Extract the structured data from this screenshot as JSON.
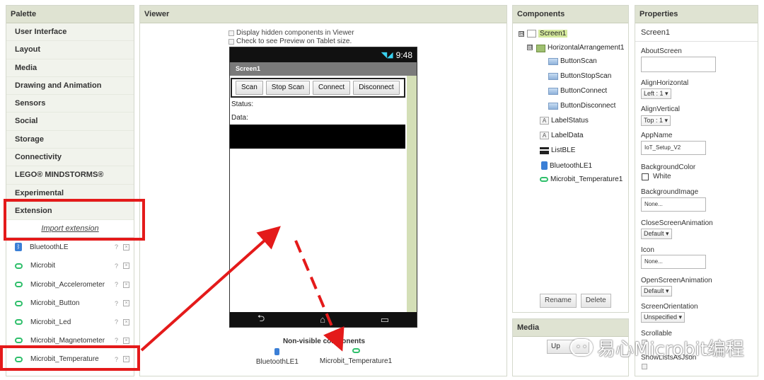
{
  "palette": {
    "title": "Palette",
    "categories": [
      "User Interface",
      "Layout",
      "Media",
      "Drawing and Animation",
      "Sensors",
      "Social",
      "Storage",
      "Connectivity",
      "LEGO® MINDSTORMS®",
      "Experimental",
      "Extension"
    ],
    "import_link": "Import extension",
    "extensions": [
      {
        "label": "BluetoothLE",
        "icon": "bluetooth-icon"
      },
      {
        "label": "Microbit",
        "icon": "microbit-icon"
      },
      {
        "label": "Microbit_Accelerometer",
        "icon": "microbit-icon"
      },
      {
        "label": "Microbit_Button",
        "icon": "microbit-icon"
      },
      {
        "label": "Microbit_Led",
        "icon": "microbit-icon"
      },
      {
        "label": "Microbit_Magnetometer",
        "icon": "microbit-icon"
      },
      {
        "label": "Microbit_Temperature",
        "icon": "microbit-icon"
      }
    ],
    "help_glyph": "?",
    "remove_glyph": "×"
  },
  "viewer": {
    "title": "Viewer",
    "display_hidden": "Display hidden components in Viewer",
    "tablet_preview": "Check to see Preview on Tablet size.",
    "phone": {
      "time": "9:48",
      "screen_title": "Screen1",
      "buttons": [
        "Scan",
        "Stop Scan",
        "Connect",
        "Disconnect"
      ],
      "status_label": "Status:",
      "data_label": "Data:",
      "nav_back": "⮌",
      "nav_home": "⌂",
      "nav_recent": "▭"
    },
    "non_visible_title": "Non-visible components",
    "non_visible_items": [
      "BluetoothLE1",
      "Microbit_Temperature1"
    ]
  },
  "components": {
    "title": "Components",
    "tree": [
      {
        "label": "Screen1",
        "icon": "screen-icon",
        "toggle": "⊟"
      },
      {
        "label": "HorizontalArrangement1",
        "icon": "arrangement-icon",
        "toggle": "⊟"
      },
      {
        "label": "ButtonScan",
        "icon": "button-icon"
      },
      {
        "label": "ButtonStopScan",
        "icon": "button-icon"
      },
      {
        "label": "ButtonConnect",
        "icon": "button-icon"
      },
      {
        "label": "ButtonDisconnect",
        "icon": "button-icon"
      },
      {
        "label": "LabelStatus",
        "icon": "label-icon"
      },
      {
        "label": "LabelData",
        "icon": "label-icon"
      },
      {
        "label": "ListBLE",
        "icon": "listview-icon"
      },
      {
        "label": "BluetoothLE1",
        "icon": "bluetooth-icon"
      },
      {
        "label": "Microbit_Temperature1",
        "icon": "microbit-icon"
      }
    ],
    "label_glyph": "A",
    "rename": "Rename",
    "delete": "Delete"
  },
  "media": {
    "title": "Media",
    "upload": "Up"
  },
  "properties": {
    "title": "Properties",
    "component": "Screen1",
    "about_screen": "AboutScreen",
    "align_horizontal": "AlignHorizontal",
    "align_horizontal_value": "Left : 1",
    "align_vertical": "AlignVertical",
    "align_vertical_value": "Top : 1",
    "app_name": "AppName",
    "app_name_value": "IoT_Setup_V2",
    "background_color": "BackgroundColor",
    "background_color_value": "White",
    "background_image": "BackgroundImage",
    "background_image_value": "None...",
    "close_anim": "CloseScreenAnimation",
    "close_anim_value": "Default",
    "icon": "Icon",
    "icon_value": "None...",
    "open_anim": "OpenScreenAnimation",
    "open_anim_value": "Default",
    "orientation": "ScreenOrientation",
    "orientation_value": "Unspecified",
    "scrollable": "Scrollable",
    "show_lists": "ShowListsAsJson"
  },
  "watermark": {
    "text": "易心Microbit编程"
  },
  "colors": {
    "header_bg": "#dfe3d2",
    "annotation_red": "#e41a1a",
    "selected_bg": "#d4e89c"
  }
}
